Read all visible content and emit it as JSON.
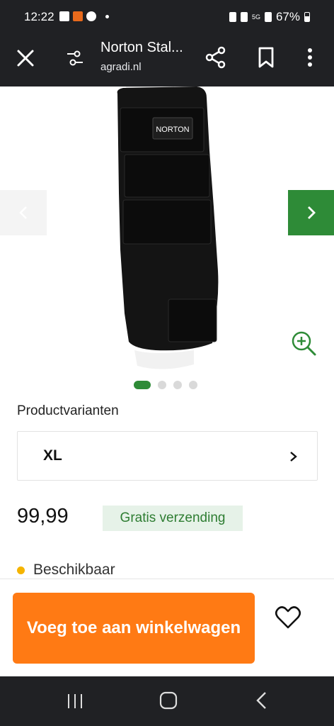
{
  "status_bar": {
    "time": "12:22",
    "battery_percent": "67%",
    "network": "5G"
  },
  "toolbar": {
    "title": "Norton Stal...",
    "url": "agradi.nl"
  },
  "gallery": {
    "brand_label": "NORTON",
    "active_index": 0,
    "total": 4
  },
  "variants": {
    "label": "Productvarianten",
    "selected": "XL"
  },
  "price": {
    "value": "99,99",
    "shipping_badge": "Gratis verzending"
  },
  "availability": {
    "text": "Beschikbaar",
    "color": "#f5b400"
  },
  "cart": {
    "button_label": "Voeg toe aan winkelwagen"
  },
  "colors": {
    "accent_green": "#2e8b37",
    "cta_orange": "#ff7a14",
    "dark_bar": "#202124"
  }
}
